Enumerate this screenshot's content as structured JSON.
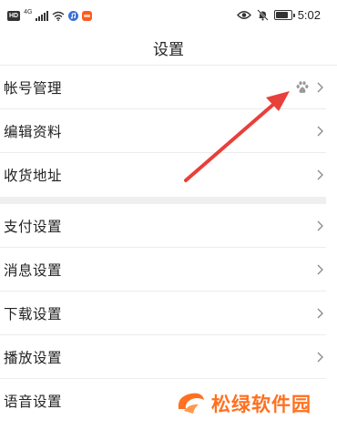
{
  "status_bar": {
    "hd_badge": "HD",
    "network_tag": "4G",
    "time": "5:02",
    "battery_level": 0.85,
    "icons": [
      "hd-badge",
      "signal-icon",
      "wifi-icon",
      "music-app-icon",
      "taobao-app-icon",
      "eye-icon",
      "bell-muted-icon",
      "battery-icon"
    ]
  },
  "header": {
    "title": "设置"
  },
  "groups": [
    {
      "items": [
        {
          "label": "帐号管理",
          "trailing_icon": "baidu-paw-icon"
        },
        {
          "label": "编辑资料"
        },
        {
          "label": "收货地址"
        }
      ]
    },
    {
      "items": [
        {
          "label": "支付设置"
        },
        {
          "label": "消息设置"
        },
        {
          "label": "下载设置"
        },
        {
          "label": "播放设置"
        },
        {
          "label": "语音设置"
        }
      ]
    }
  ],
  "annotation": {
    "type": "red-arrow",
    "color": "#e8403a",
    "points_to": "baidu-paw-icon"
  },
  "watermark": {
    "text": "松绿软件园",
    "color": "#ff7020"
  }
}
